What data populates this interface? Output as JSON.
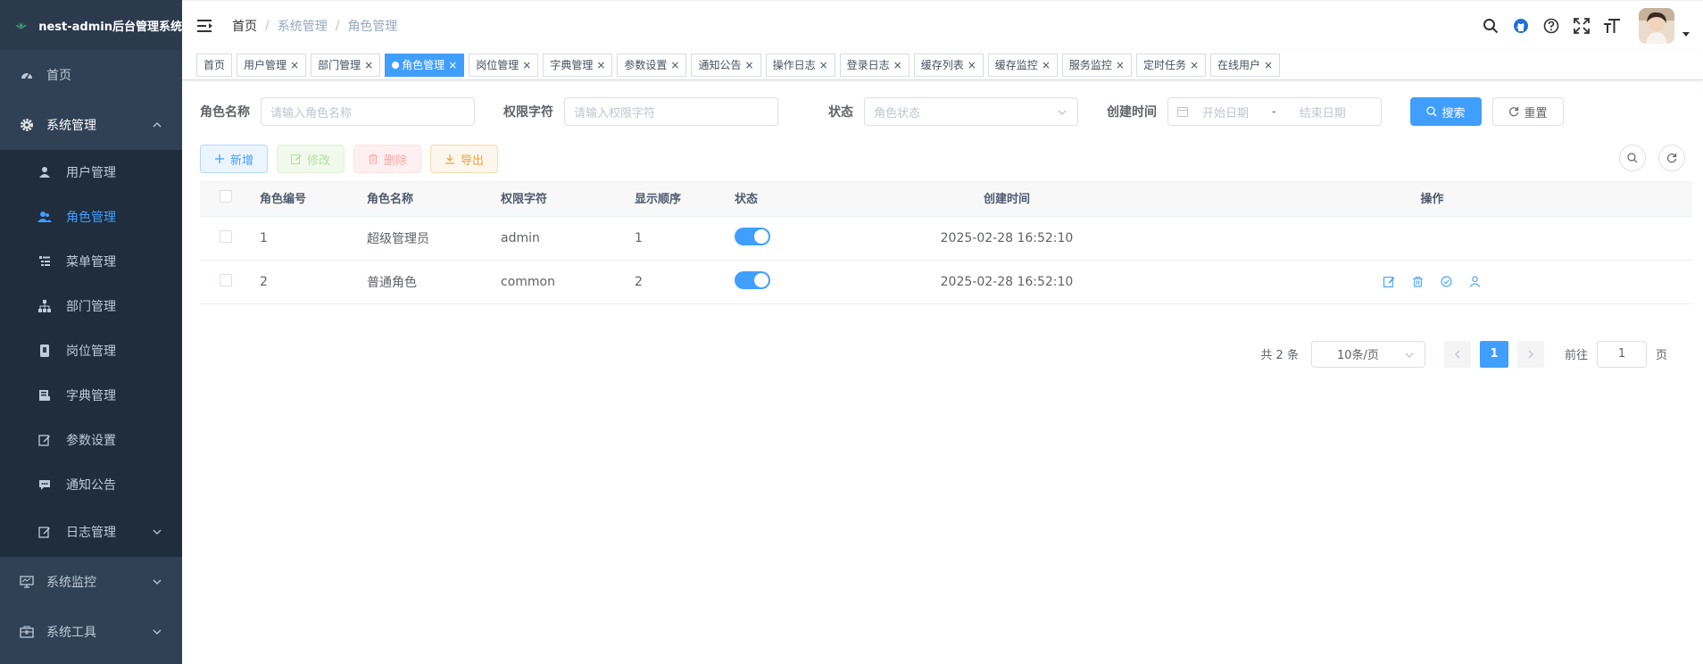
{
  "app": {
    "title": "nest-admin后台管理系统"
  },
  "colors": {
    "sidebar_bg": "#304156",
    "primary": "#409eff",
    "active_menu": "#409eff"
  },
  "sidebar": {
    "home": "首页",
    "system": "系统管理",
    "system_items": [
      {
        "label": "用户管理",
        "icon": "user-icon"
      },
      {
        "label": "角色管理",
        "icon": "peoples-icon"
      },
      {
        "label": "菜单管理",
        "icon": "tree-table-icon"
      },
      {
        "label": "部门管理",
        "icon": "tree-icon"
      },
      {
        "label": "岗位管理",
        "icon": "post-icon"
      },
      {
        "label": "字典管理",
        "icon": "dict-icon"
      },
      {
        "label": "参数设置",
        "icon": "edit-icon"
      },
      {
        "label": "通知公告",
        "icon": "message-icon"
      },
      {
        "label": "日志管理",
        "icon": "log-icon"
      }
    ],
    "monitor": "系统监控",
    "tool": "系统工具"
  },
  "breadcrumb": [
    "首页",
    "系统管理",
    "角色管理"
  ],
  "tags": [
    "首页",
    "用户管理",
    "部门管理",
    "角色管理",
    "岗位管理",
    "字典管理",
    "参数设置",
    "通知公告",
    "操作日志",
    "登录日志",
    "缓存列表",
    "缓存监控",
    "服务监控",
    "定时任务",
    "在线用户"
  ],
  "active_tag": "角色管理",
  "search": {
    "role_name_label": "角色名称",
    "role_name_placeholder": "请输入角色名称",
    "role_key_label": "权限字符",
    "role_key_placeholder": "请输入权限字符",
    "status_label": "状态",
    "status_placeholder": "角色状态",
    "create_time_label": "创建时间",
    "start_placeholder": "开始日期",
    "range_sep": "-",
    "end_placeholder": "结束日期",
    "search_btn": "搜索",
    "reset_btn": "重置"
  },
  "toolbar": {
    "add": "新增",
    "edit": "修改",
    "delete": "删除",
    "export": "导出"
  },
  "table": {
    "headers": [
      "角色编号",
      "角色名称",
      "权限字符",
      "显示顺序",
      "状态",
      "创建时间",
      "操作"
    ],
    "rows": [
      {
        "id": "1",
        "name": "超级管理员",
        "key": "admin",
        "sort": "1",
        "enabled": true,
        "created": "2025-02-28 16:52:10",
        "has_ops": false
      },
      {
        "id": "2",
        "name": "普通角色",
        "key": "common",
        "sort": "2",
        "enabled": true,
        "created": "2025-02-28 16:52:10",
        "has_ops": true
      }
    ]
  },
  "pagination": {
    "total_text": "共 2 条",
    "page_size": "10条/页",
    "current": "1",
    "goto_label": "前往",
    "goto_value": "1",
    "page_unit": "页"
  }
}
